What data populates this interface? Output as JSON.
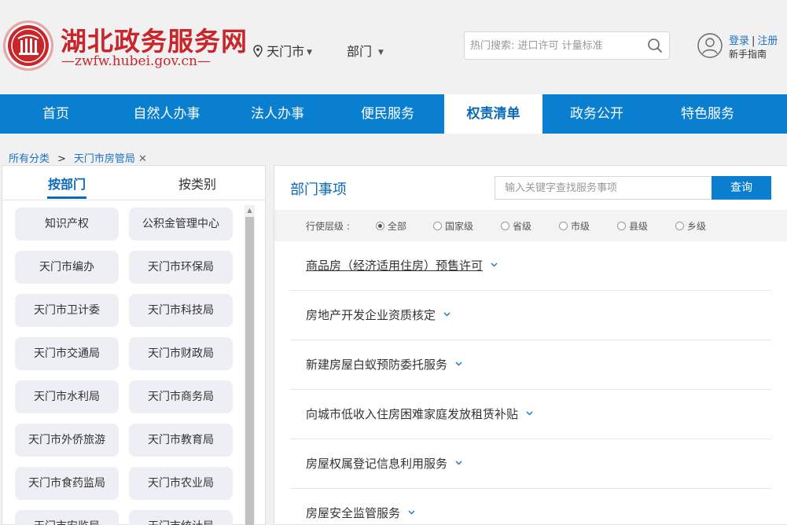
{
  "header": {
    "logo_title": "湖北政务服务网",
    "logo_url": "—zwfw.hubei.gov.cn—",
    "location": "天门市",
    "department": "部门",
    "search_placeholder": "热门搜索: 进口许可 计量标准",
    "login": "登录",
    "register": "注册",
    "divider": "|",
    "guide": "新手指南"
  },
  "nav": {
    "items": [
      {
        "label": "首页"
      },
      {
        "label": "自然人办事"
      },
      {
        "label": "法人办事"
      },
      {
        "label": "便民服务"
      },
      {
        "label": "权责清单",
        "active": true
      },
      {
        "label": "政务公开"
      },
      {
        "label": "特色服务"
      }
    ]
  },
  "breadcrumb": {
    "root": "所有分类",
    "sep": ">",
    "current": "天门市房管局",
    "close": "✕"
  },
  "left": {
    "tab_active": "按部门",
    "tab_other": "按类别",
    "departments": [
      "知识产权",
      "公积金管理中心",
      "天门市编办",
      "天门市环保局",
      "天门市卫计委",
      "天门市科技局",
      "天门市交通局",
      "天门市财政局",
      "天门市水利局",
      "天门市商务局",
      "天门市外侨旅游",
      "天门市教育局",
      "天门市食药监局",
      "天门市农业局",
      "天门市安监局",
      "天门市统计局"
    ]
  },
  "right": {
    "title": "部门事项",
    "keyword_placeholder": "输入关键字查找服务事项",
    "query_button": "查询",
    "level_label": "行使层级 :",
    "levels": [
      "全部",
      "国家级",
      "省级",
      "市级",
      "县级",
      "乡级"
    ],
    "selected_level": "全部",
    "items": [
      "商品房（经济适用住房）预售许可",
      "房地产开发企业资质核定",
      "新建房屋白蚁预防委托服务",
      "向城市低收入住房困难家庭发放租赁补贴",
      "房屋权属登记信息利用服务",
      "房屋安全监管服务"
    ]
  },
  "colors": {
    "brand_red": "#c9262b",
    "nav_blue": "#0a7fd0",
    "link_blue": "#1a73c4"
  }
}
